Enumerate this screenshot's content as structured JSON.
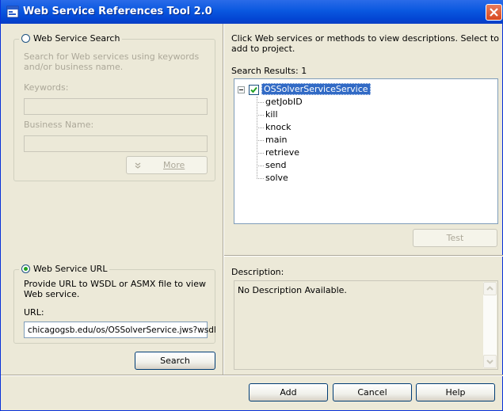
{
  "window": {
    "title": "Web Service References Tool 2.0"
  },
  "left": {
    "search_group": {
      "radio_label": "Web Service Search",
      "description": "Search for Web services using keywords and/or business name.",
      "keywords_label": "Keywords:",
      "keywords_value": "",
      "business_label": "Business Name:",
      "business_value": "",
      "more_label": "More"
    },
    "url_group": {
      "radio_label": "Web Service URL",
      "description": "Provide URL to WSDL or ASMX file to view Web service.",
      "url_label": "URL:",
      "url_value": "chicagogsb.edu/os/OSSolverService.jws?wsdl",
      "search_label": "Search"
    }
  },
  "right": {
    "instructions": "Click Web services or methods to view descriptions. Select to add to project.",
    "results_label": "Search Results: 1",
    "tree": {
      "root": "OSSolverServiceService",
      "children": [
        "getJobID",
        "kill",
        "knock",
        "main",
        "retrieve",
        "send",
        "solve"
      ]
    },
    "test_label": "Test",
    "description_label": "Description:",
    "description_text": "No Description Available."
  },
  "footer": {
    "add_label": "Add",
    "cancel_label": "Cancel",
    "help_label": "Help"
  },
  "colors": {
    "titlebar": "#0a58e0",
    "selection": "#316ac5",
    "dialog_bg": "#ece9d8"
  }
}
